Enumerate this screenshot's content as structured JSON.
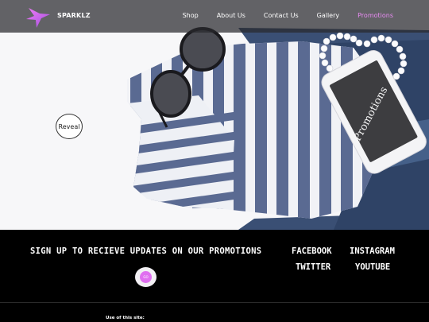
{
  "nav": {
    "brand": "SPARKLZ",
    "links": [
      {
        "label": "Shop"
      },
      {
        "label": "About Us"
      },
      {
        "label": "Contact Us"
      },
      {
        "label": "Gallery"
      },
      {
        "label": "Promotions"
      }
    ],
    "active": "Promotions",
    "accent_color": "#e98cf3"
  },
  "hero": {
    "reveal_label": "Reveal",
    "phone_text": "Promotions"
  },
  "footer": {
    "signup_text": "SIGN UP TO RECIEVE UPDATES ON OUR PROMOTIONS",
    "social": {
      "facebook": "FACEBOOK",
      "instagram": "INSTAGRAM",
      "twitter": "TWITTER",
      "youtube": "YOUTUBE"
    },
    "subscribe_label": "GO",
    "use_of_site": "Use of this site:"
  }
}
